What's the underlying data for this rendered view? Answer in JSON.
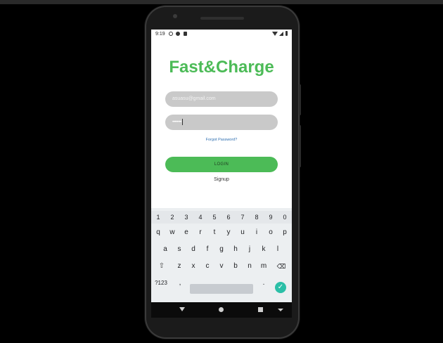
{
  "status_bar": {
    "time": "9:19"
  },
  "app": {
    "title": "Fast&Charge",
    "email_value": "asuasu@gmail.com",
    "password_dots": "••••••••",
    "forgot_label": "Forgot Password?",
    "login_label": "LOGIN",
    "signup_label": "Signup"
  },
  "keyboard": {
    "numbers": [
      "1",
      "2",
      "3",
      "4",
      "5",
      "6",
      "7",
      "8",
      "9",
      "0"
    ],
    "row1": [
      "q",
      "w",
      "e",
      "r",
      "t",
      "y",
      "u",
      "i",
      "o",
      "p"
    ],
    "row2": [
      "a",
      "s",
      "d",
      "f",
      "g",
      "h",
      "j",
      "k",
      "l"
    ],
    "row3": [
      "z",
      "x",
      "c",
      "v",
      "b",
      "n",
      "m"
    ],
    "symbols_key": "?123",
    "comma": ",",
    "period": ".",
    "shift_glyph": "⇧",
    "delete_glyph": "⌫",
    "enter_glyph": "✓"
  },
  "colors": {
    "brand_green": "#4cbb57",
    "field_gray": "#c9c9c9",
    "enter_teal": "#2bbfa7"
  }
}
